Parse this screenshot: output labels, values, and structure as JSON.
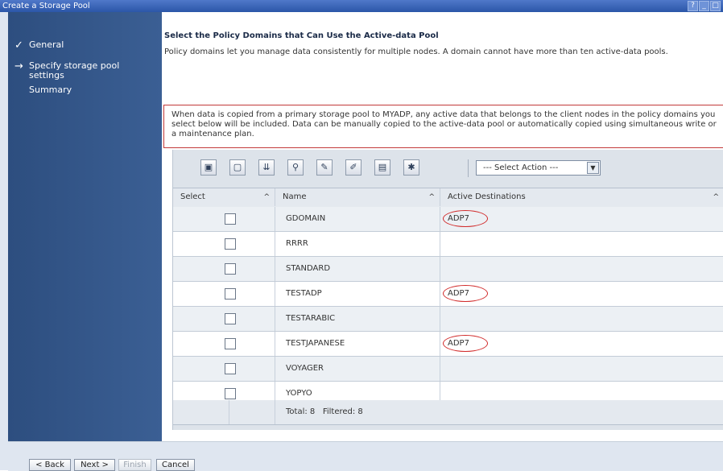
{
  "window": {
    "title": "Create a Storage Pool",
    "controls": [
      "?",
      "_",
      "□"
    ]
  },
  "sidebar": {
    "steps": [
      {
        "label": "General",
        "state": "completed",
        "marker": "✓"
      },
      {
        "label": "Specify storage pool settings",
        "state": "current",
        "marker": "→"
      },
      {
        "label": "Summary",
        "state": "pending",
        "marker": ""
      }
    ]
  },
  "main": {
    "heading": "Select the Policy Domains that Can Use the Active-data Pool",
    "description": "Policy domains let you manage data consistently for multiple nodes. A domain cannot have more than ten active-data pools.",
    "note": "When data is copied from a primary storage pool to MYADP, any active data that belongs to the client nodes in the policy domains you select below will be included. Data can be manually copied to the active-data pool or automatically copied using simultaneous write or a maintenance plan."
  },
  "toolbar": {
    "icons": [
      "select-all-icon",
      "deselect-all-icon",
      "show-filter-icon",
      "edit-sort-icon",
      "clear-filter-icon",
      "clear-sort-icon",
      "collapse-table-icon",
      "configure-table-icon"
    ],
    "action_select": {
      "selected": "--- Select Action ---"
    }
  },
  "table": {
    "columns": [
      "Select",
      "Name",
      "Active Destinations"
    ],
    "rows": [
      {
        "name": "GDOMAIN",
        "dest": "ADP7"
      },
      {
        "name": "RRRR",
        "dest": ""
      },
      {
        "name": "STANDARD",
        "dest": ""
      },
      {
        "name": "TESTADP",
        "dest": "ADP7"
      },
      {
        "name": "TESTARABIC",
        "dest": ""
      },
      {
        "name": "TESTJAPANESE",
        "dest": "ADP7"
      },
      {
        "name": "VOYAGER",
        "dest": ""
      },
      {
        "name": "YOPYO",
        "dest": ""
      }
    ],
    "footer": {
      "total_label": "Total: 8",
      "filtered_label": "Filtered: 8"
    }
  },
  "nav": {
    "back": "< Back",
    "next": "Next >",
    "finish": "Finish",
    "cancel": "Cancel"
  },
  "colors": {
    "sidebar_bg": "#2d4e7f",
    "highlight_oval": "#d12a2a",
    "note_border": "#c23a3a"
  }
}
